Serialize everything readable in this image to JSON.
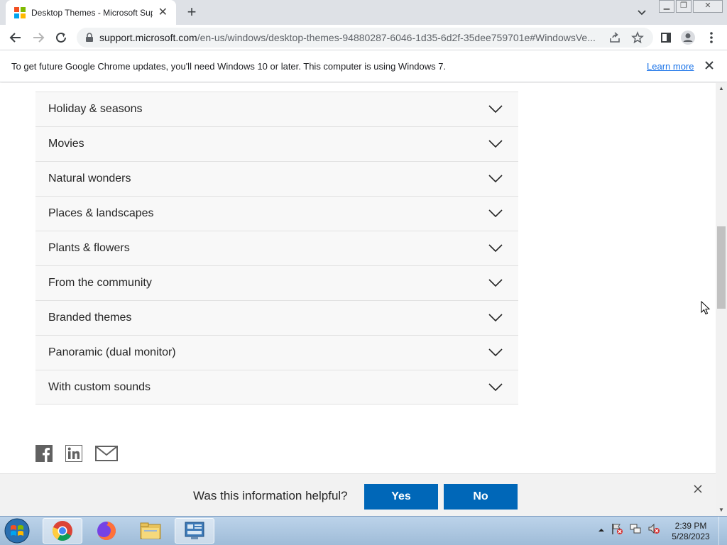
{
  "browser": {
    "tab_title": "Desktop Themes - Microsoft Sup",
    "url_host": "support.microsoft.com",
    "url_path": "/en-us/windows/desktop-themes-94880287-6046-1d35-6d2f-35dee759701e#WindowsVe..."
  },
  "infobar": {
    "message": "To get future Google Chrome updates, you'll need Windows 10 or later. This computer is using Windows 7.",
    "link": "Learn more"
  },
  "accordion": [
    {
      "label": "Holiday & seasons"
    },
    {
      "label": "Movies"
    },
    {
      "label": "Natural wonders"
    },
    {
      "label": "Places & landscapes"
    },
    {
      "label": "Plants & flowers"
    },
    {
      "label": "From the community"
    },
    {
      "label": "Branded themes"
    },
    {
      "label": "Panoramic (dual monitor)"
    },
    {
      "label": "With custom sounds"
    }
  ],
  "share": [
    "facebook-icon",
    "linkedin-icon",
    "email-icon"
  ],
  "feedback": {
    "question": "Was this information helpful?",
    "yes": "Yes",
    "no": "No"
  },
  "taskbar": {
    "time": "2:39 PM",
    "date": "5/28/2023",
    "apps": [
      "chrome-icon",
      "firefox-icon",
      "file-explorer-icon",
      "control-panel-icon"
    ]
  },
  "colors": {
    "accent": "#0067b8",
    "link": "#1a73e8",
    "accordion_bg": "#f8f8f8"
  }
}
